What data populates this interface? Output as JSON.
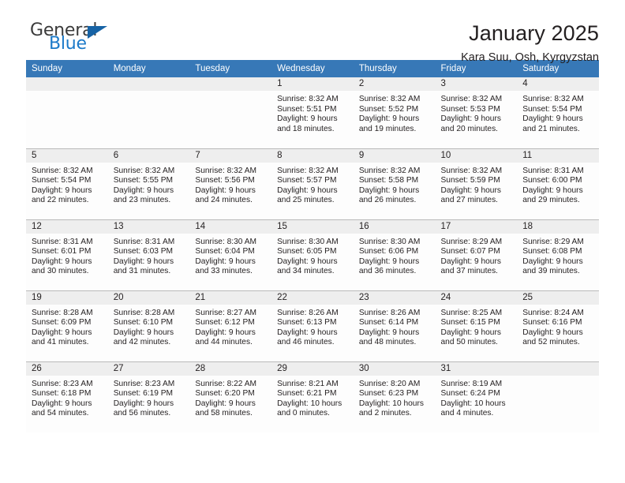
{
  "brand": {
    "name_part1": "General",
    "name_part2": "Blue",
    "triangle_color": "#1763a5",
    "blue_color": "#1c7ac9"
  },
  "header": {
    "title": "January 2025",
    "subtitle": "Kara Suu, Osh, Kyrgyzstan",
    "header_bg": "#3778b7",
    "daynum_band_bg": "#eeeeee"
  },
  "weekdays": [
    "Sunday",
    "Monday",
    "Tuesday",
    "Wednesday",
    "Thursday",
    "Friday",
    "Saturday"
  ],
  "labels": {
    "sunrise_prefix": "Sunrise:",
    "sunset_prefix": "Sunset:",
    "daylight_prefix": "Daylight:"
  },
  "weeks": [
    [
      {
        "empty": true
      },
      {
        "empty": true
      },
      {
        "empty": true
      },
      {
        "day": "1",
        "sunrise": "Sunrise: 8:32 AM",
        "sunset": "Sunset: 5:51 PM",
        "daylight_line1": "Daylight: 9 hours",
        "daylight_line2": "and 18 minutes."
      },
      {
        "day": "2",
        "sunrise": "Sunrise: 8:32 AM",
        "sunset": "Sunset: 5:52 PM",
        "daylight_line1": "Daylight: 9 hours",
        "daylight_line2": "and 19 minutes."
      },
      {
        "day": "3",
        "sunrise": "Sunrise: 8:32 AM",
        "sunset": "Sunset: 5:53 PM",
        "daylight_line1": "Daylight: 9 hours",
        "daylight_line2": "and 20 minutes."
      },
      {
        "day": "4",
        "sunrise": "Sunrise: 8:32 AM",
        "sunset": "Sunset: 5:54 PM",
        "daylight_line1": "Daylight: 9 hours",
        "daylight_line2": "and 21 minutes."
      }
    ],
    [
      {
        "day": "5",
        "sunrise": "Sunrise: 8:32 AM",
        "sunset": "Sunset: 5:54 PM",
        "daylight_line1": "Daylight: 9 hours",
        "daylight_line2": "and 22 minutes."
      },
      {
        "day": "6",
        "sunrise": "Sunrise: 8:32 AM",
        "sunset": "Sunset: 5:55 PM",
        "daylight_line1": "Daylight: 9 hours",
        "daylight_line2": "and 23 minutes."
      },
      {
        "day": "7",
        "sunrise": "Sunrise: 8:32 AM",
        "sunset": "Sunset: 5:56 PM",
        "daylight_line1": "Daylight: 9 hours",
        "daylight_line2": "and 24 minutes."
      },
      {
        "day": "8",
        "sunrise": "Sunrise: 8:32 AM",
        "sunset": "Sunset: 5:57 PM",
        "daylight_line1": "Daylight: 9 hours",
        "daylight_line2": "and 25 minutes."
      },
      {
        "day": "9",
        "sunrise": "Sunrise: 8:32 AM",
        "sunset": "Sunset: 5:58 PM",
        "daylight_line1": "Daylight: 9 hours",
        "daylight_line2": "and 26 minutes."
      },
      {
        "day": "10",
        "sunrise": "Sunrise: 8:32 AM",
        "sunset": "Sunset: 5:59 PM",
        "daylight_line1": "Daylight: 9 hours",
        "daylight_line2": "and 27 minutes."
      },
      {
        "day": "11",
        "sunrise": "Sunrise: 8:31 AM",
        "sunset": "Sunset: 6:00 PM",
        "daylight_line1": "Daylight: 9 hours",
        "daylight_line2": "and 29 minutes."
      }
    ],
    [
      {
        "day": "12",
        "sunrise": "Sunrise: 8:31 AM",
        "sunset": "Sunset: 6:01 PM",
        "daylight_line1": "Daylight: 9 hours",
        "daylight_line2": "and 30 minutes."
      },
      {
        "day": "13",
        "sunrise": "Sunrise: 8:31 AM",
        "sunset": "Sunset: 6:03 PM",
        "daylight_line1": "Daylight: 9 hours",
        "daylight_line2": "and 31 minutes."
      },
      {
        "day": "14",
        "sunrise": "Sunrise: 8:30 AM",
        "sunset": "Sunset: 6:04 PM",
        "daylight_line1": "Daylight: 9 hours",
        "daylight_line2": "and 33 minutes."
      },
      {
        "day": "15",
        "sunrise": "Sunrise: 8:30 AM",
        "sunset": "Sunset: 6:05 PM",
        "daylight_line1": "Daylight: 9 hours",
        "daylight_line2": "and 34 minutes."
      },
      {
        "day": "16",
        "sunrise": "Sunrise: 8:30 AM",
        "sunset": "Sunset: 6:06 PM",
        "daylight_line1": "Daylight: 9 hours",
        "daylight_line2": "and 36 minutes."
      },
      {
        "day": "17",
        "sunrise": "Sunrise: 8:29 AM",
        "sunset": "Sunset: 6:07 PM",
        "daylight_line1": "Daylight: 9 hours",
        "daylight_line2": "and 37 minutes."
      },
      {
        "day": "18",
        "sunrise": "Sunrise: 8:29 AM",
        "sunset": "Sunset: 6:08 PM",
        "daylight_line1": "Daylight: 9 hours",
        "daylight_line2": "and 39 minutes."
      }
    ],
    [
      {
        "day": "19",
        "sunrise": "Sunrise: 8:28 AM",
        "sunset": "Sunset: 6:09 PM",
        "daylight_line1": "Daylight: 9 hours",
        "daylight_line2": "and 41 minutes."
      },
      {
        "day": "20",
        "sunrise": "Sunrise: 8:28 AM",
        "sunset": "Sunset: 6:10 PM",
        "daylight_line1": "Daylight: 9 hours",
        "daylight_line2": "and 42 minutes."
      },
      {
        "day": "21",
        "sunrise": "Sunrise: 8:27 AM",
        "sunset": "Sunset: 6:12 PM",
        "daylight_line1": "Daylight: 9 hours",
        "daylight_line2": "and 44 minutes."
      },
      {
        "day": "22",
        "sunrise": "Sunrise: 8:26 AM",
        "sunset": "Sunset: 6:13 PM",
        "daylight_line1": "Daylight: 9 hours",
        "daylight_line2": "and 46 minutes."
      },
      {
        "day": "23",
        "sunrise": "Sunrise: 8:26 AM",
        "sunset": "Sunset: 6:14 PM",
        "daylight_line1": "Daylight: 9 hours",
        "daylight_line2": "and 48 minutes."
      },
      {
        "day": "24",
        "sunrise": "Sunrise: 8:25 AM",
        "sunset": "Sunset: 6:15 PM",
        "daylight_line1": "Daylight: 9 hours",
        "daylight_line2": "and 50 minutes."
      },
      {
        "day": "25",
        "sunrise": "Sunrise: 8:24 AM",
        "sunset": "Sunset: 6:16 PM",
        "daylight_line1": "Daylight: 9 hours",
        "daylight_line2": "and 52 minutes."
      }
    ],
    [
      {
        "day": "26",
        "sunrise": "Sunrise: 8:23 AM",
        "sunset": "Sunset: 6:18 PM",
        "daylight_line1": "Daylight: 9 hours",
        "daylight_line2": "and 54 minutes."
      },
      {
        "day": "27",
        "sunrise": "Sunrise: 8:23 AM",
        "sunset": "Sunset: 6:19 PM",
        "daylight_line1": "Daylight: 9 hours",
        "daylight_line2": "and 56 minutes."
      },
      {
        "day": "28",
        "sunrise": "Sunrise: 8:22 AM",
        "sunset": "Sunset: 6:20 PM",
        "daylight_line1": "Daylight: 9 hours",
        "daylight_line2": "and 58 minutes."
      },
      {
        "day": "29",
        "sunrise": "Sunrise: 8:21 AM",
        "sunset": "Sunset: 6:21 PM",
        "daylight_line1": "Daylight: 10 hours",
        "daylight_line2": "and 0 minutes."
      },
      {
        "day": "30",
        "sunrise": "Sunrise: 8:20 AM",
        "sunset": "Sunset: 6:23 PM",
        "daylight_line1": "Daylight: 10 hours",
        "daylight_line2": "and 2 minutes."
      },
      {
        "day": "31",
        "sunrise": "Sunrise: 8:19 AM",
        "sunset": "Sunset: 6:24 PM",
        "daylight_line1": "Daylight: 10 hours",
        "daylight_line2": "and 4 minutes."
      },
      {
        "empty": true
      }
    ]
  ]
}
